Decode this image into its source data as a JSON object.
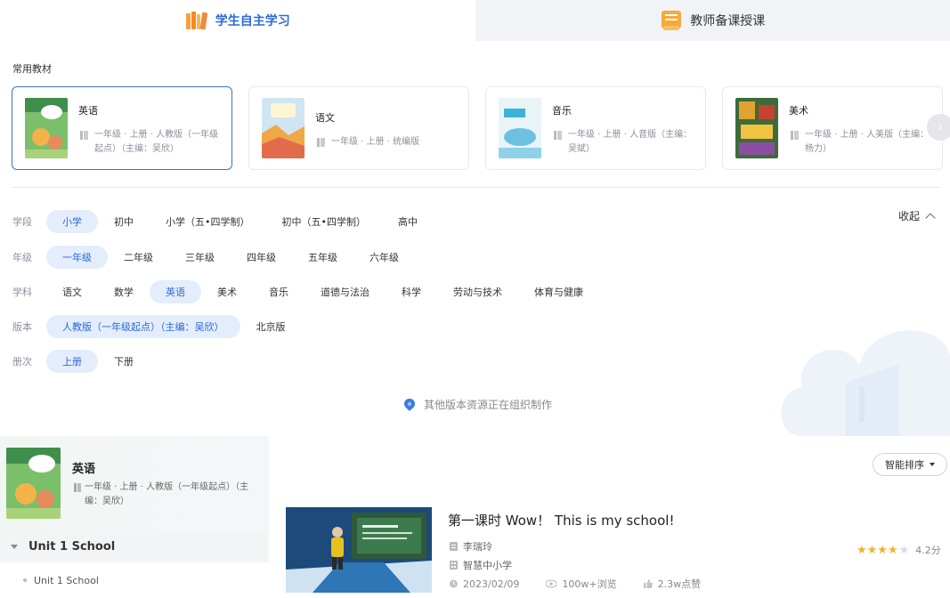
{
  "top_tabs": [
    {
      "label": "学生自主学习",
      "active": true,
      "icon": "books-icon"
    },
    {
      "label": "教师备课授课",
      "active": false,
      "icon": "lesson-plan-icon"
    }
  ],
  "section_title": "常用教材",
  "books": [
    {
      "name": "英语",
      "meta": "一年级 · 上册 · 人教版（一年级起点）（主编：吴欣）",
      "selected": true
    },
    {
      "name": "语文",
      "meta": "一年级 · 上册 · 统编版",
      "selected": false
    },
    {
      "name": "音乐",
      "meta": "一年级 · 上册 · 人音版（主编：吴斌）",
      "selected": false
    },
    {
      "name": "美术",
      "meta": "一年级 · 上册 · 人美版（主编：杨力）",
      "selected": false
    }
  ],
  "filters": {
    "stage": {
      "label": "学段",
      "options": [
        "小学",
        "初中",
        "小学（五•四学制）",
        "初中（五•四学制）",
        "高中"
      ],
      "active": 0
    },
    "grade": {
      "label": "年级",
      "options": [
        "一年级",
        "二年级",
        "三年级",
        "四年级",
        "五年级",
        "六年级"
      ],
      "active": 0
    },
    "subject": {
      "label": "学科",
      "options": [
        "语文",
        "数学",
        "英语",
        "美术",
        "音乐",
        "道德与法治",
        "科学",
        "劳动与技术",
        "体育与健康"
      ],
      "active": 2
    },
    "edition": {
      "label": "版本",
      "options": [
        "人教版（一年级起点）（主编：吴欣）",
        "北京版"
      ],
      "active": 0
    },
    "volume": {
      "label": "册次",
      "options": [
        "上册",
        "下册"
      ],
      "active": 0
    }
  },
  "collapse_label": "收起",
  "note": "其他版本资源正在组织制作",
  "left_panel": {
    "title": "英语",
    "meta": "一年级 · 上册 · 人教版（一年级起点）（主编：吴欣）",
    "unit": "Unit 1 School",
    "lesson": "Unit 1 School"
  },
  "sort_label": "智能排序",
  "resource": {
    "title": "第一课时 Wow！ This is my school!",
    "teacher": "李瑞玲",
    "source": "智慧中小学",
    "date": "2023/02/09",
    "views": "100w+浏览",
    "likes": "2.3w点赞",
    "rating": 4.2,
    "rating_text": "4.2分"
  },
  "colors": {
    "accent": "#2a6ad8",
    "star": "#f0b429",
    "selected_border": "#3a74c9"
  }
}
